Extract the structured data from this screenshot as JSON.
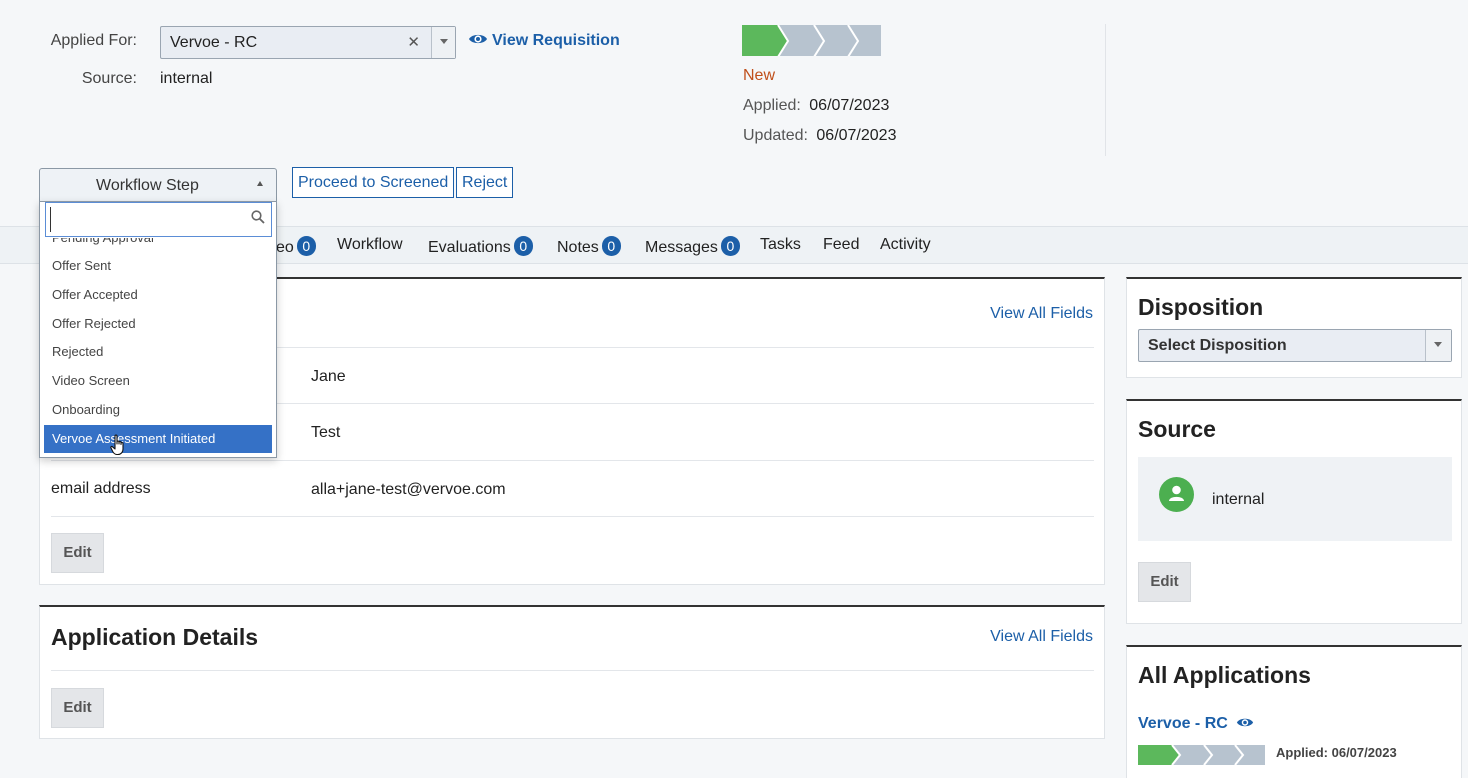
{
  "header": {
    "applied_for_label": "Applied For:",
    "applied_for_value": "Vervoe - RC",
    "source_label": "Source:",
    "source_value": "internal",
    "view_requisition": "View Requisition",
    "status": "New",
    "applied_label": "Applied:",
    "applied_date": "06/07/2023",
    "updated_label": "Updated:",
    "updated_date": "06/07/2023",
    "progress_fraction": 0.2,
    "colors": {
      "done": "#5cb85c",
      "todo": "#b7c3cf",
      "status": "#c0501c",
      "link": "#1c5fa8"
    }
  },
  "workflow": {
    "select_label": "Workflow Step",
    "proceed_button": "Proceed to Screened",
    "reject_button": "Reject",
    "search_placeholder": "",
    "options": [
      "Pending Approval",
      "Offer Sent",
      "Offer Accepted",
      "Offer Rejected",
      "Rejected",
      "Video Screen",
      "Onboarding",
      "Vervoe Assessment Initiated"
    ],
    "highlighted_option": "Vervoe Assessment Initiated"
  },
  "tabs": [
    {
      "label": "eo",
      "count": "0"
    },
    {
      "label": "Workflow"
    },
    {
      "label": "Evaluations",
      "count": "0"
    },
    {
      "label": "Notes",
      "count": "0"
    },
    {
      "label": "Messages",
      "count": "0"
    },
    {
      "label": "Tasks"
    },
    {
      "label": "Feed"
    },
    {
      "label": "Activity"
    }
  ],
  "candidate": {
    "view_all_fields": "View All Fields",
    "first_name": "Jane",
    "last_name": "Test",
    "email_label": "email address",
    "email_value": "alla+jane-test@vervoe.com",
    "edit_button": "Edit"
  },
  "application_details": {
    "title": "Application Details",
    "view_all_fields": "View All Fields",
    "edit_button": "Edit"
  },
  "disposition": {
    "title": "Disposition",
    "placeholder": "Select Disposition"
  },
  "source_panel": {
    "title": "Source",
    "value": "internal",
    "edit_button": "Edit"
  },
  "all_applications": {
    "title": "All Applications",
    "job_link": "Vervoe - RC",
    "applied_text": "Applied: 06/07/2023"
  }
}
